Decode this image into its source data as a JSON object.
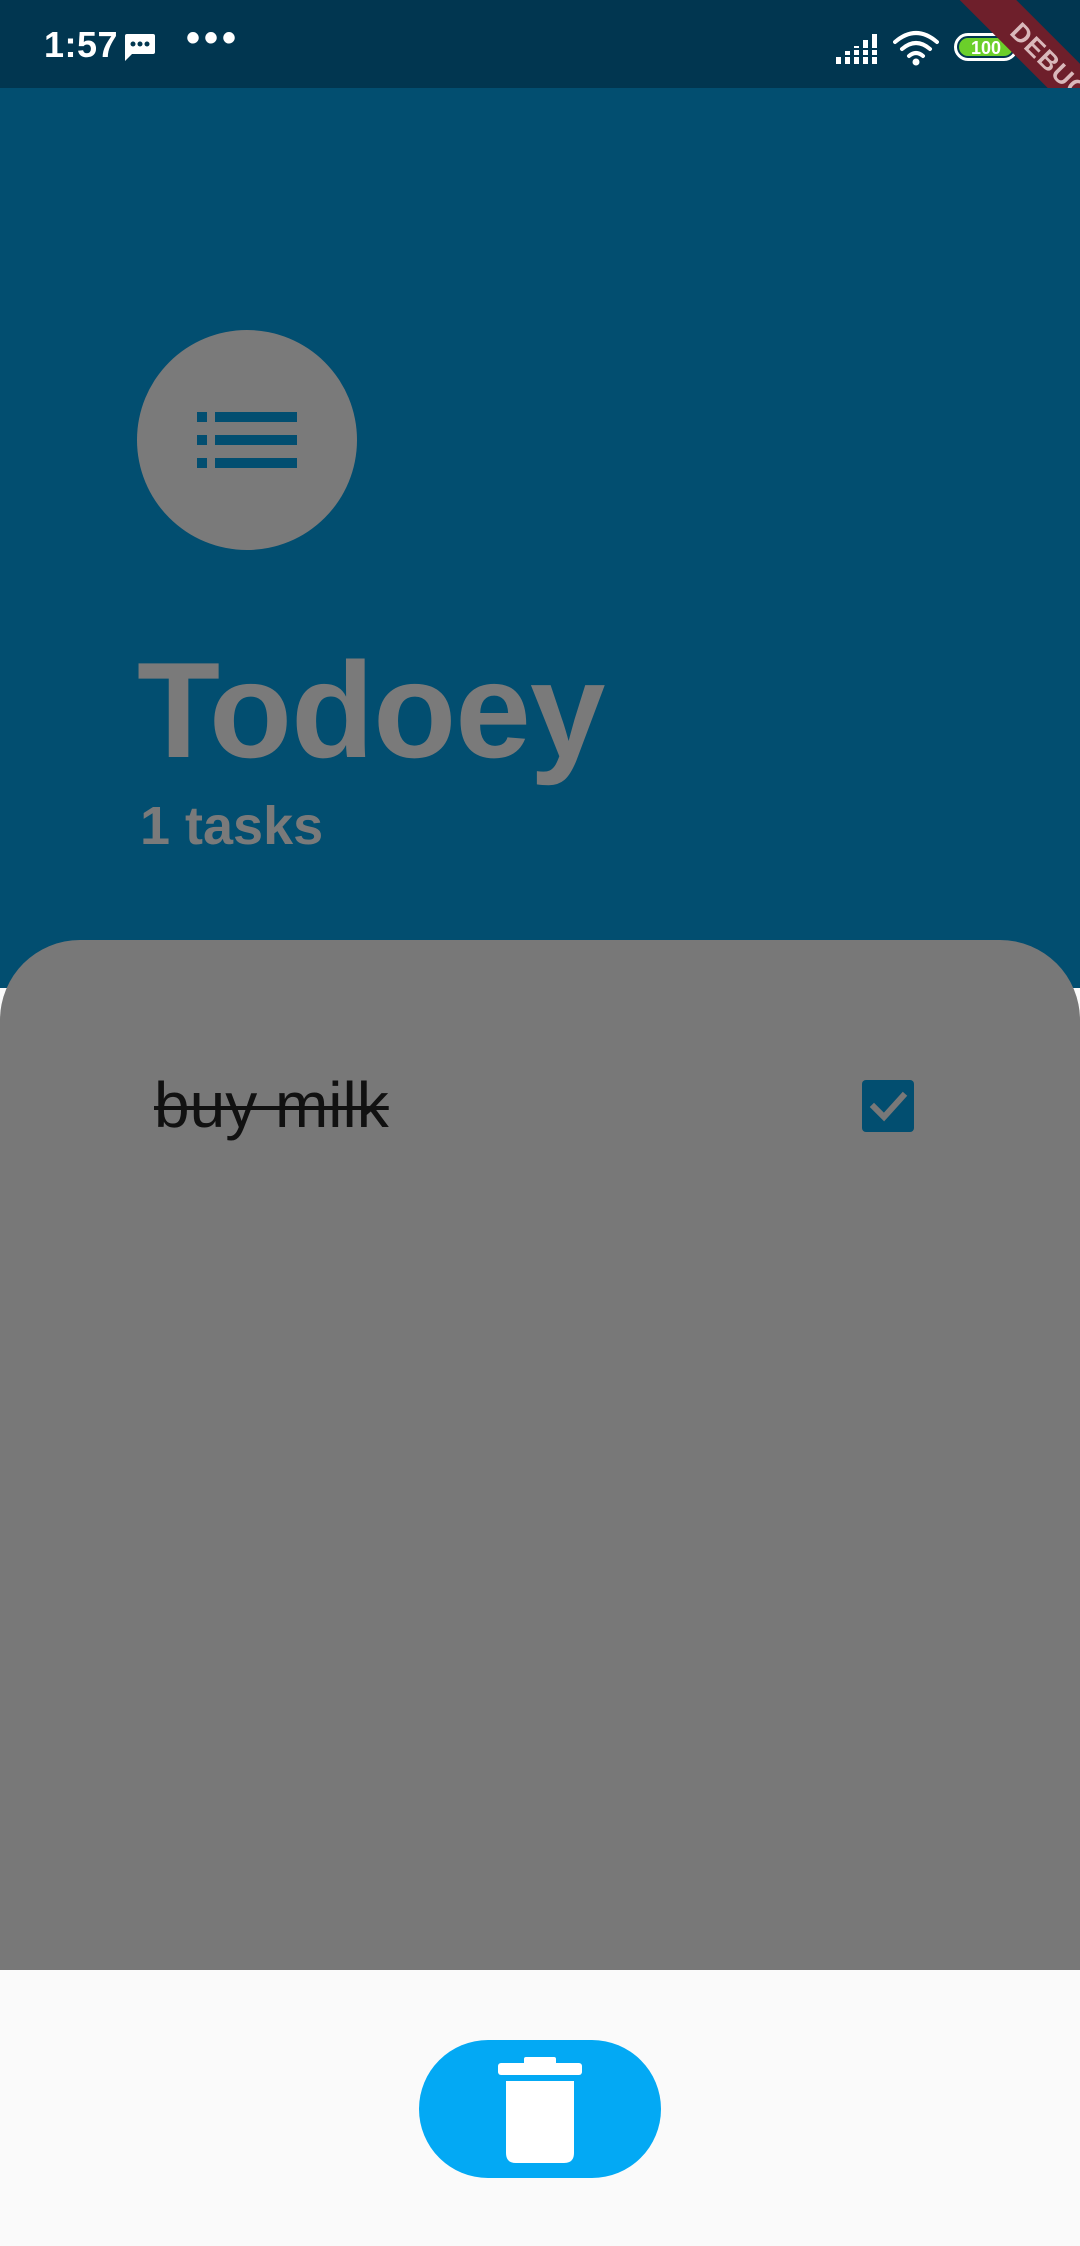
{
  "status_bar": {
    "time": "1:57",
    "more": "•••",
    "battery": "100",
    "icons": [
      "message-icon",
      "signal-icon",
      "wifi-icon",
      "battery-icon"
    ]
  },
  "debug_banner": {
    "label": "DEBUG"
  },
  "header": {
    "icon": "list-icon",
    "title": "Todoey",
    "task_count": "1 tasks"
  },
  "tasks": [
    {
      "title": "buy milk",
      "done": true
    }
  ],
  "delete_button": {
    "icon": "trash-icon"
  },
  "colors": {
    "status_bar": "#013650",
    "header": "#024e70",
    "sheet": "#787878",
    "checkbox": "#024e70",
    "delete_button": "#03a9f4",
    "bottom": "#fafafa"
  }
}
